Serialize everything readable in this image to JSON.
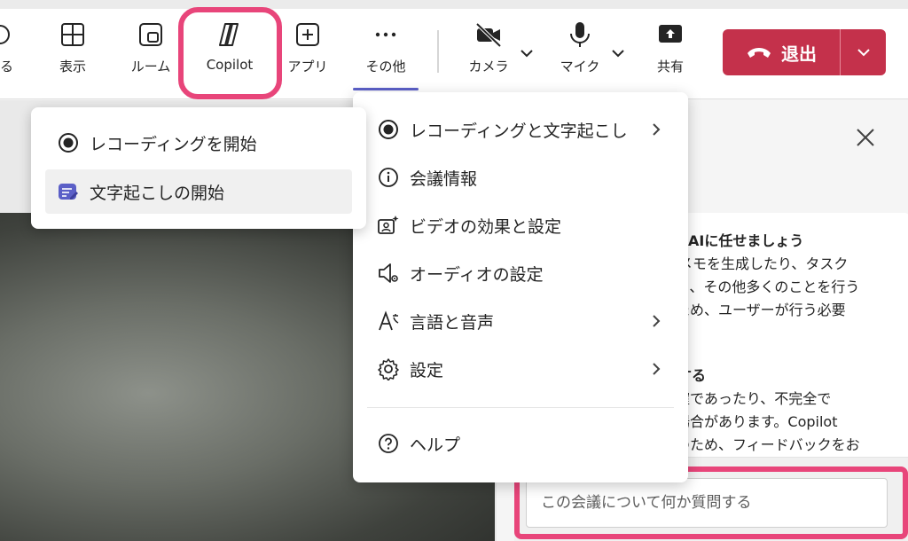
{
  "toolbar": {
    "buttons": {
      "partial": "する",
      "view": "表示",
      "rooms": "ルーム",
      "copilot": "Copilot",
      "apps": "アプリ",
      "more": "その他",
      "camera": "カメラ",
      "mic": "マイク",
      "share": "共有"
    },
    "leave_label": "退出"
  },
  "recording_submenu": {
    "items": [
      {
        "label": "レコーディングを開始",
        "icon": "record-icon"
      },
      {
        "label": "文字起こしの開始",
        "icon": "transcript-icon"
      }
    ]
  },
  "more_menu": {
    "items": [
      {
        "label": "レコーディングと文字起こし",
        "icon": "record-icon",
        "has_submenu": true
      },
      {
        "label": "会議情報",
        "icon": "info-icon",
        "has_submenu": false
      },
      {
        "label": "ビデオの効果と設定",
        "icon": "video-effects-icon",
        "has_submenu": false
      },
      {
        "label": "オーディオの設定",
        "icon": "speaker-settings-icon",
        "has_submenu": false
      },
      {
        "label": "言語と音声",
        "icon": "language-icon",
        "has_submenu": true
      },
      {
        "label": "設定",
        "icon": "gear-icon",
        "has_submenu": true
      }
    ],
    "help_label": "ヘルプ"
  },
  "copilot_panel": {
    "card_lines": [
      "はAIに任せましょう",
      "メモを生成したり、タスク",
      "り、その他多くのことを行う",
      "ため、ユーザーが行う必要",
      "。",
      "する",
      "確であったり、不完全で",
      "場合があります。Copilot",
      "のため、フィードバックをお"
    ],
    "input_placeholder": "この会議について何か質問する"
  },
  "colors": {
    "accent": "#5b5fc7",
    "leave": "#c4314b",
    "highlight": "#e8457a"
  }
}
